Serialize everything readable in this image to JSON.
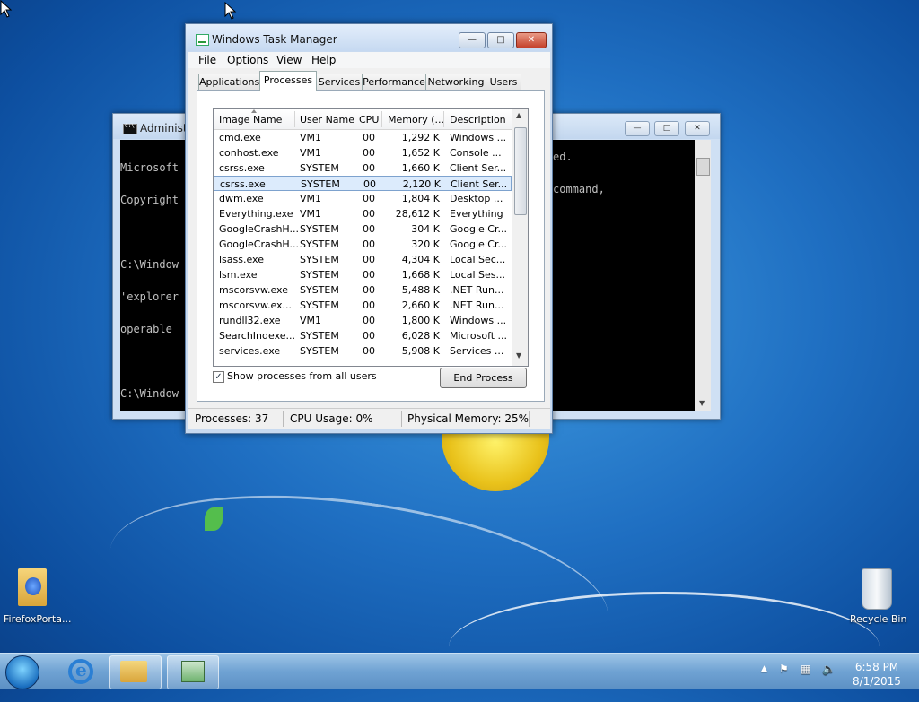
{
  "console_window": {
    "title": "Administ",
    "lines": [
      "Microsoft",
      "Copyright",
      "",
      "C:\\Window",
      "'explorer",
      "operable",
      "",
      "C:\\Window"
    ],
    "right_fragments": {
      "line1": "ed.",
      "line4": "command,"
    }
  },
  "task_manager": {
    "title": "Windows Task Manager",
    "menu": [
      "File",
      "Options",
      "View",
      "Help"
    ],
    "tabs": [
      "Applications",
      "Processes",
      "Services",
      "Performance",
      "Networking",
      "Users"
    ],
    "active_tab": "Processes",
    "columns": [
      "Image Name",
      "User Name",
      "CPU",
      "Memory (...",
      "Description"
    ],
    "rows": [
      {
        "name": "cmd.exe",
        "user": "VM1",
        "cpu": "00",
        "mem": "1,292 K",
        "desc": "Windows ..."
      },
      {
        "name": "conhost.exe",
        "user": "VM1",
        "cpu": "00",
        "mem": "1,652 K",
        "desc": "Console ..."
      },
      {
        "name": "csrss.exe",
        "user": "SYSTEM",
        "cpu": "00",
        "mem": "1,660 K",
        "desc": "Client Ser..."
      },
      {
        "name": "csrss.exe",
        "user": "SYSTEM",
        "cpu": "00",
        "mem": "2,120 K",
        "desc": "Client Ser..."
      },
      {
        "name": "dwm.exe",
        "user": "VM1",
        "cpu": "00",
        "mem": "1,804 K",
        "desc": "Desktop ..."
      },
      {
        "name": "Everything.exe",
        "user": "VM1",
        "cpu": "00",
        "mem": "28,612 K",
        "desc": "Everything"
      },
      {
        "name": "GoogleCrashH...",
        "user": "SYSTEM",
        "cpu": "00",
        "mem": "304 K",
        "desc": "Google Cr..."
      },
      {
        "name": "GoogleCrashH...",
        "user": "SYSTEM",
        "cpu": "00",
        "mem": "320 K",
        "desc": "Google Cr..."
      },
      {
        "name": "lsass.exe",
        "user": "SYSTEM",
        "cpu": "00",
        "mem": "4,304 K",
        "desc": "Local Sec..."
      },
      {
        "name": "lsm.exe",
        "user": "SYSTEM",
        "cpu": "00",
        "mem": "1,668 K",
        "desc": "Local Ses..."
      },
      {
        "name": "mscorsvw.exe",
        "user": "SYSTEM",
        "cpu": "00",
        "mem": "5,488 K",
        "desc": ".NET Run..."
      },
      {
        "name": "mscorsvw.ex...",
        "user": "SYSTEM",
        "cpu": "00",
        "mem": "2,660 K",
        "desc": ".NET Run..."
      },
      {
        "name": "rundll32.exe",
        "user": "VM1",
        "cpu": "00",
        "mem": "1,800 K",
        "desc": "Windows ..."
      },
      {
        "name": "SearchIndexe...",
        "user": "SYSTEM",
        "cpu": "00",
        "mem": "6,028 K",
        "desc": "Microsoft ..."
      },
      {
        "name": "services.exe",
        "user": "SYSTEM",
        "cpu": "00",
        "mem": "5,908 K",
        "desc": "Services ..."
      }
    ],
    "selected_row": 3,
    "show_all_label": "Show processes from all users",
    "show_all_checked": true,
    "end_process_label": "End Process",
    "status": {
      "processes": "Processes: 37",
      "cpu": "CPU Usage: 0%",
      "memory": "Physical Memory: 25%"
    }
  },
  "desktop": {
    "firefox_label": "FirefoxPorta...",
    "recycle_label": "Recycle Bin"
  },
  "taskbar": {
    "time": "6:58 PM",
    "date": "8/1/2015",
    "tray_arrow": "▲"
  },
  "colors": {
    "selection_bg": "#dcebfc",
    "close_button": "#c4402b",
    "desktop_blue": "#1f6fc2"
  }
}
